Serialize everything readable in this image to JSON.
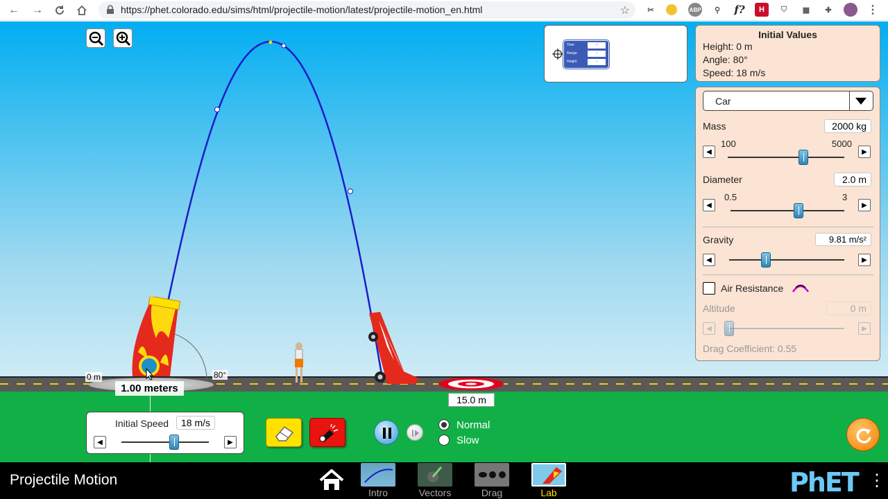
{
  "browser": {
    "url": "https://phet.colorado.edu/sims/html/projectile-motion/latest/projectile-motion_en.html"
  },
  "initial_values": {
    "title": "Initial Values",
    "height": "Height: 0 m",
    "angle": "Angle: 80°",
    "speed": "Speed: 18 m/s"
  },
  "measuring_tool": {
    "time_label": "Time",
    "range_label": "Range",
    "height_label": "Height",
    "time_value": "-",
    "range_value": "-",
    "height_value": "-"
  },
  "projectile_panel": {
    "selected_object": "Car",
    "mass_label": "Mass",
    "mass_value": "2000 kg",
    "mass_min": "100",
    "mass_max": "5000",
    "mass_fraction": 0.65,
    "diameter_label": "Diameter",
    "diameter_value": "2.0 m",
    "diameter_min": "0.5",
    "diameter_max": "3",
    "diameter_fraction": 0.6,
    "gravity_label": "Gravity",
    "gravity_value": "9.81 m/s²",
    "gravity_fraction": 0.32,
    "air_resistance_label": "Air Resistance",
    "air_resistance_checked": false,
    "altitude_label": "Altitude",
    "altitude_value": "0 m",
    "altitude_fraction": 0.0,
    "drag_coefficient": "Drag Coefficient: 0.55"
  },
  "cannon": {
    "height_label": "0 m",
    "angle_label": "80°",
    "tape_label": "1.00 meters"
  },
  "target": {
    "distance_label": "15.0 m"
  },
  "launch_panel": {
    "speed_label": "Initial Speed",
    "speed_value": "18 m/s",
    "speed_fraction": 0.6
  },
  "playback": {
    "normal_label": "Normal",
    "slow_label": "Slow",
    "selected_speed": "Normal"
  },
  "navbar": {
    "title": "Projectile Motion",
    "screens": [
      "Intro",
      "Vectors",
      "Drag",
      "Lab"
    ],
    "active_screen": "Lab",
    "brand": "PhET"
  },
  "colors": {
    "sky_top": "#02aef1",
    "ground": "#11b047",
    "trajectory": "#1c1cc8",
    "panel_bg": "#fbe4d3",
    "fire_button": "#e8140f",
    "eraser_button": "#ffe100",
    "reset_button": "#f7941d"
  }
}
